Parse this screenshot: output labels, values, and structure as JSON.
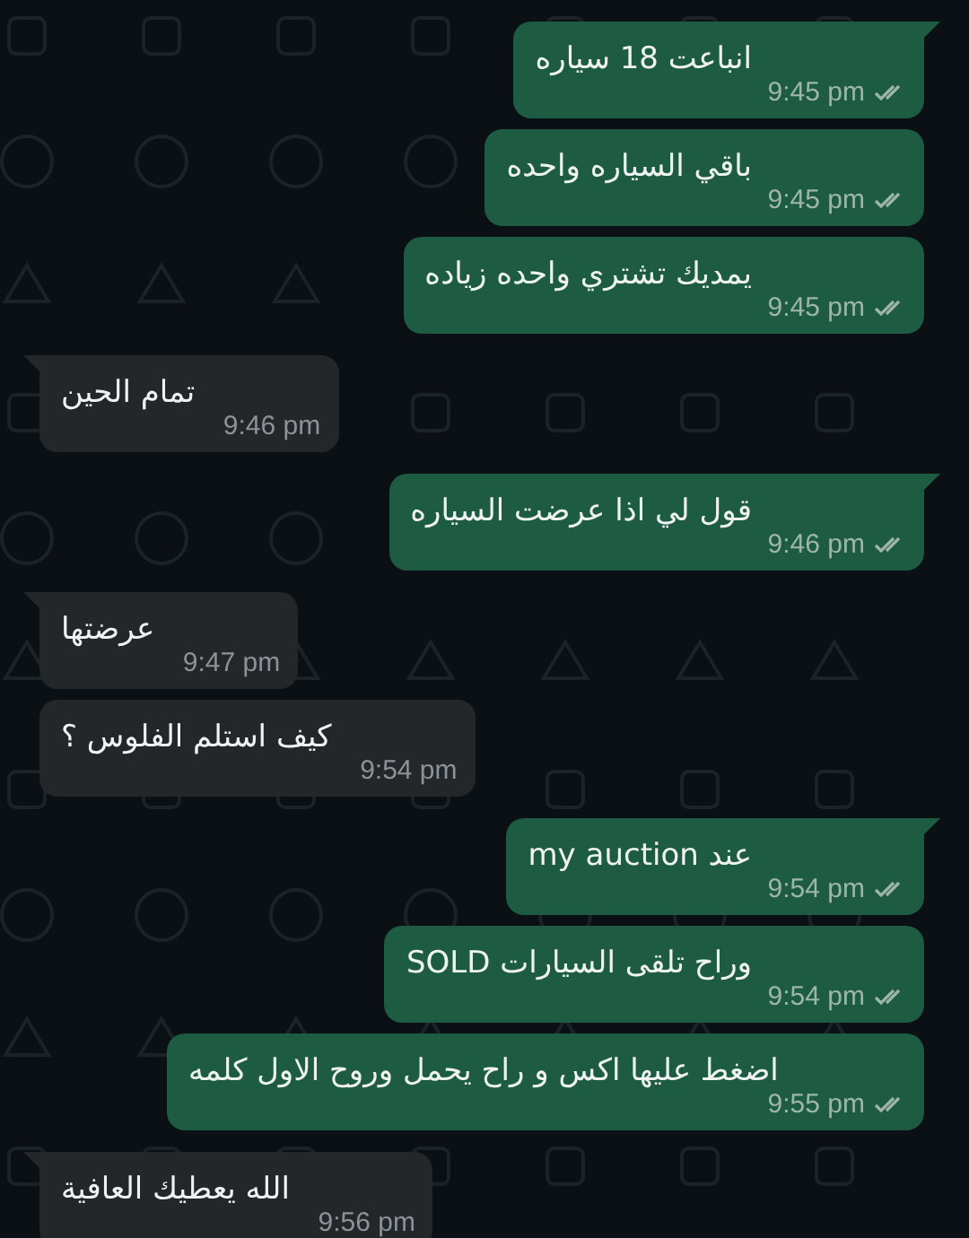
{
  "messages": [
    {
      "kind": "sent",
      "text": "انباعت 18 سياره",
      "time": "9:45 pm",
      "read": false,
      "tail": true
    },
    {
      "kind": "sent",
      "text": "باقي السياره واحده",
      "time": "9:45 pm",
      "read": false,
      "tail": false
    },
    {
      "kind": "sent",
      "text": "يمديك تشتري واحده زياده",
      "time": "9:45 pm",
      "read": false,
      "tail": false
    },
    {
      "kind": "received",
      "text": "تمام الحين",
      "time": "9:46 pm",
      "tail": true
    },
    {
      "kind": "sent",
      "text": "قول لي اذا عرضت السياره",
      "time": "9:46 pm",
      "read": false,
      "tail": true
    },
    {
      "kind": "received",
      "text": "عرضتها",
      "time": "9:47 pm",
      "tail": true
    },
    {
      "kind": "received",
      "text": "كيف استلم الفلوس ؟",
      "time": "9:54 pm",
      "tail": false
    },
    {
      "kind": "sent",
      "text": "عند my auction",
      "time": "9:54 pm",
      "read": false,
      "tail": true
    },
    {
      "kind": "sent",
      "text": "وراح تلقى السيارات SOLD",
      "time": "9:54 pm",
      "read": false,
      "tail": false
    },
    {
      "kind": "sent",
      "text": "اضغط عليها اكس و راح يحمل وروح الاول كلمه",
      "time": "9:55 pm",
      "read": false,
      "tail": false
    },
    {
      "kind": "received",
      "text": "الله يعطيك العافية",
      "time": "9:56 pm",
      "tail": true
    }
  ]
}
